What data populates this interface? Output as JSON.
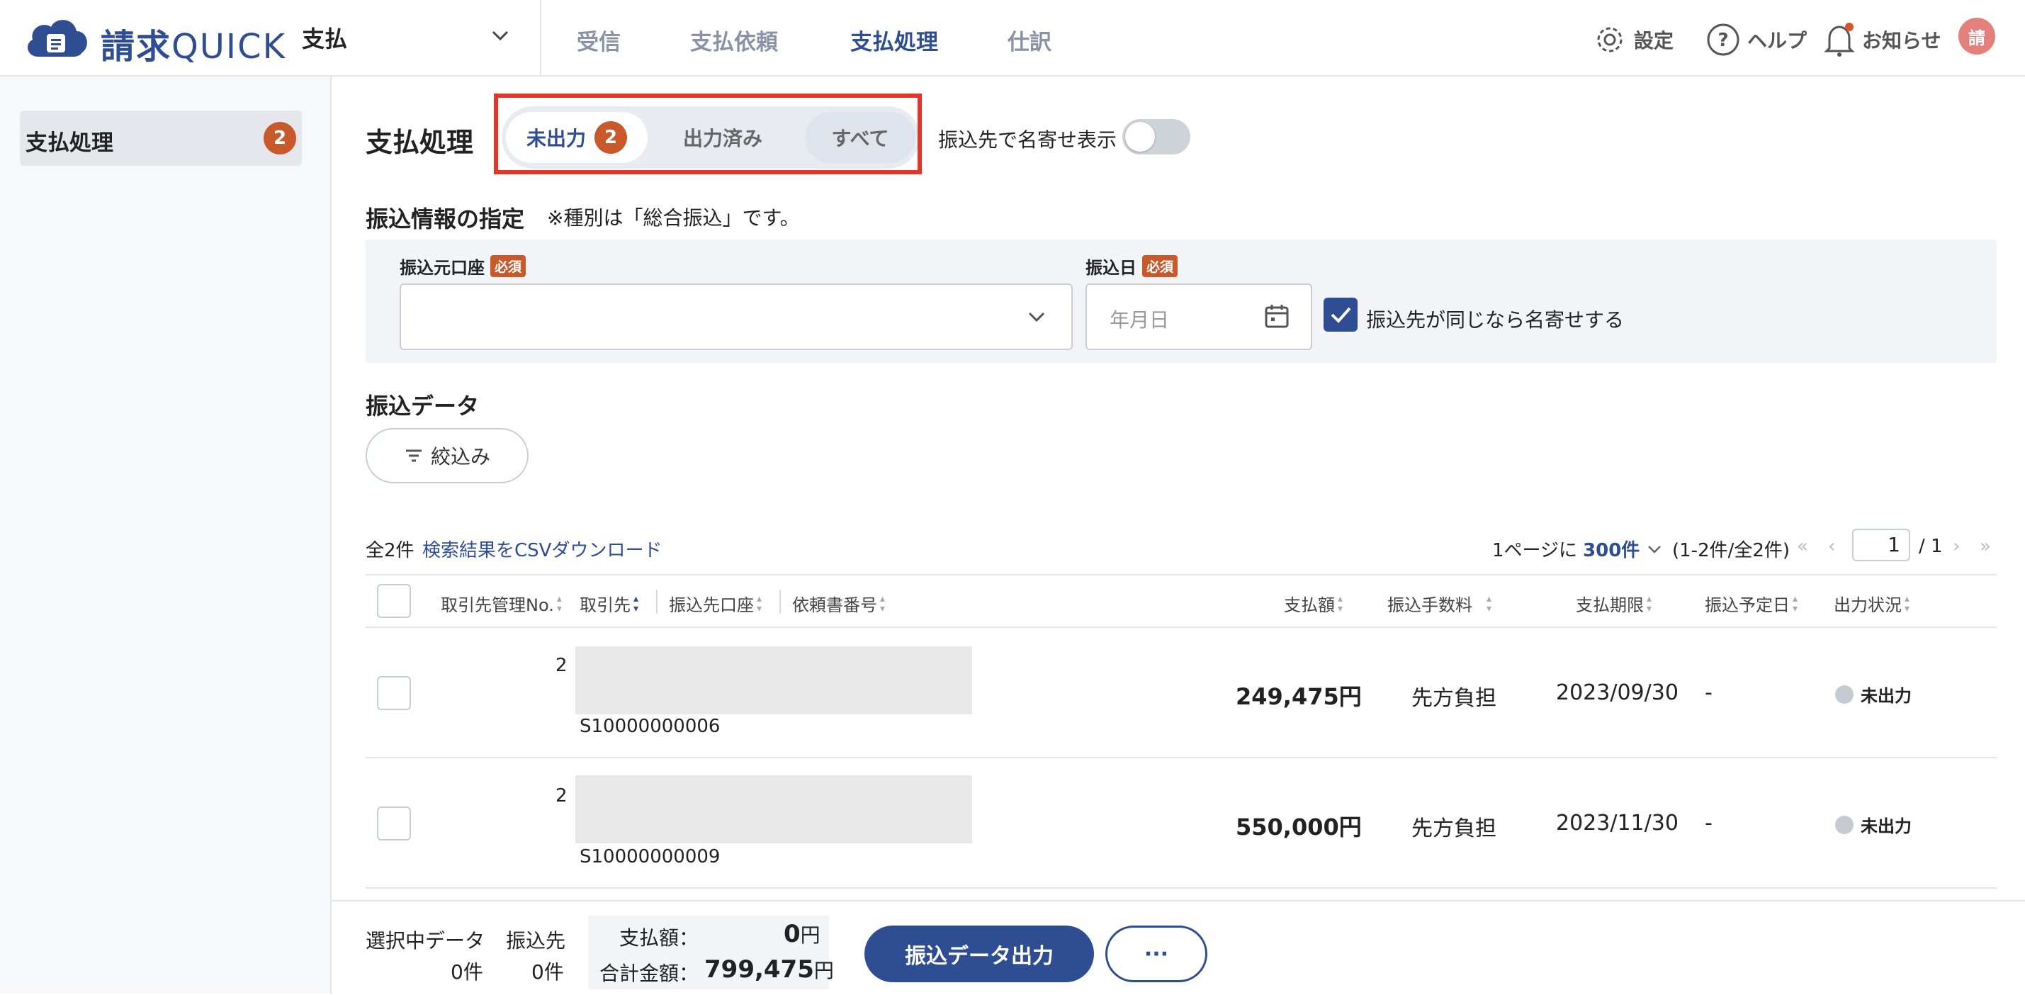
{
  "app": {
    "logo_kanji": "請求",
    "logo_latin": "QUICK",
    "module": "支払"
  },
  "nav": [
    "受信",
    "支払依頼",
    "支払処理",
    "仕訳"
  ],
  "header_right": {
    "settings": "設定",
    "help": "ヘルプ",
    "notifications": "お知らせ",
    "avatar": "請"
  },
  "sidebar": {
    "items": [
      {
        "label": "支払処理",
        "badge": "2"
      }
    ]
  },
  "main": {
    "title": "支払処理",
    "tabs": [
      {
        "label": "未出力",
        "badge": "2"
      },
      {
        "label": "出力済み"
      },
      {
        "label": "すべて"
      }
    ],
    "toggle_label": "振込先で名寄せ表示",
    "toggle_on": false
  },
  "transfer_info": {
    "title": "振込情報の指定",
    "note": "※種別は「総合振込」です。",
    "account_label": "振込元口座",
    "required": "必須",
    "date_label": "振込日",
    "date_placeholder": "年月日",
    "merge_checkbox_label": "振込先が同じなら名寄せする",
    "merge_checked": true
  },
  "transfer_data": {
    "title": "振込データ",
    "filter_button": "絞込み",
    "total_count": "全2件",
    "csv_link": "検索結果をCSVダウンロード",
    "per_page_prefix": "1ページに",
    "per_page_value": "300件",
    "range": "(1-2件/全2件)",
    "page_current": "1",
    "page_total": "/ 1"
  },
  "table": {
    "columns": [
      "取引先管理No.",
      "取引先",
      "振込先口座",
      "依頼書番号",
      "支払額",
      "振込手数料",
      "支払期限",
      "振込予定日",
      "出力状況"
    ],
    "rows": [
      {
        "mgmt_no": "2",
        "request_no": "S10000000006",
        "amount": "249,475円",
        "fee": "先方負担",
        "due": "2023/09/30",
        "scheduled": "-",
        "status": "未出力"
      },
      {
        "mgmt_no": "2",
        "request_no": "S10000000009",
        "amount": "550,000円",
        "fee": "先方負担",
        "due": "2023/11/30",
        "scheduled": "-",
        "status": "未出力"
      }
    ]
  },
  "bottom": {
    "selected_label": "選択中データ",
    "selected_count": "0件",
    "payee_label": "振込先",
    "payee_count": "0件",
    "amount_label": "支払額：",
    "amount_value": "0",
    "total_label": "合計金額：",
    "total_value": "799,475",
    "yen": "円",
    "export_button": "振込データ出力",
    "more_button": "···"
  },
  "colors": {
    "brand": "#2f4d92",
    "badge": "#c8592a",
    "highlight": "#e53528"
  }
}
